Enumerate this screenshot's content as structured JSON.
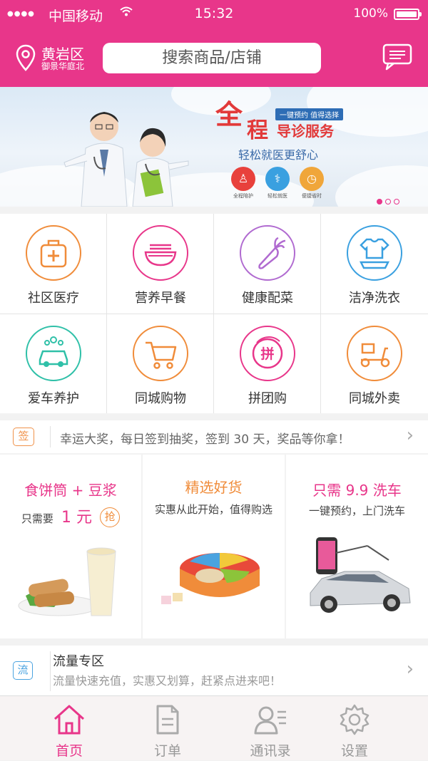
{
  "status_bar": {
    "carrier": "中国移动",
    "time": "15:32",
    "battery": "100%"
  },
  "header": {
    "location_district": "黄岩区",
    "location_sub": "御景华庭北",
    "search_placeholder": "搜索商品/店铺"
  },
  "banner": {
    "badge": "一键预约 值得选择",
    "title_char1": "全",
    "title_char2": "程",
    "title_rest": "导诊服务",
    "subtitle": "轻松就医更舒心",
    "features": [
      "全程陪护",
      "轻松就医",
      "便捷省时"
    ],
    "pagination": {
      "count": 3,
      "active": 1
    }
  },
  "services": [
    {
      "label": "社区医疗",
      "icon": "medical-kit-icon",
      "color": "#f08c3a"
    },
    {
      "label": "营养早餐",
      "icon": "noodle-bowl-icon",
      "color": "#e8368a"
    },
    {
      "label": "健康配菜",
      "icon": "carrot-icon",
      "color": "#b06ad0"
    },
    {
      "label": "洁净洗衣",
      "icon": "laundry-icon",
      "color": "#3aa0e0"
    },
    {
      "label": "爱车养护",
      "icon": "car-wash-icon",
      "color": "#2fc0a8"
    },
    {
      "label": "同城购物",
      "icon": "shopping-cart-icon",
      "color": "#f08c3a"
    },
    {
      "label": "拼团购",
      "icon": "group-buy-icon",
      "color": "#e8368a",
      "glyph": "拼"
    },
    {
      "label": "同城外卖",
      "icon": "scooter-icon",
      "color": "#f08c3a"
    }
  ],
  "notice": {
    "badge": "签",
    "text": "幸运大奖，每日签到抽奖，签到 30 天，奖品等你拿！"
  },
  "promos": [
    {
      "title": "食饼筒 + 豆浆",
      "price_prefix": "只需要",
      "price": "1 元",
      "grab": "抢",
      "color": "#e8368a"
    },
    {
      "title": "精选好货",
      "subtitle": "实惠从此开始，值得购选",
      "color": "#f08c3a"
    },
    {
      "title": "只需 9.9 洗车",
      "subtitle": "一键预约，上门洗车",
      "color": "#e8368a"
    }
  ],
  "traffic": {
    "badge": "流",
    "title": "流量专区",
    "subtitle": "流量快速充值，实惠又划算，赶紧点进来吧！"
  },
  "tabs": [
    {
      "label": "首页",
      "icon": "home-icon",
      "active": true
    },
    {
      "label": "订单",
      "icon": "order-icon",
      "active": false
    },
    {
      "label": "通讯录",
      "icon": "contacts-icon",
      "active": false
    },
    {
      "label": "设置",
      "icon": "settings-icon",
      "active": false
    }
  ],
  "colors": {
    "brand": "#e8368a",
    "orange": "#f08c3a",
    "blue": "#3aa0e0"
  }
}
